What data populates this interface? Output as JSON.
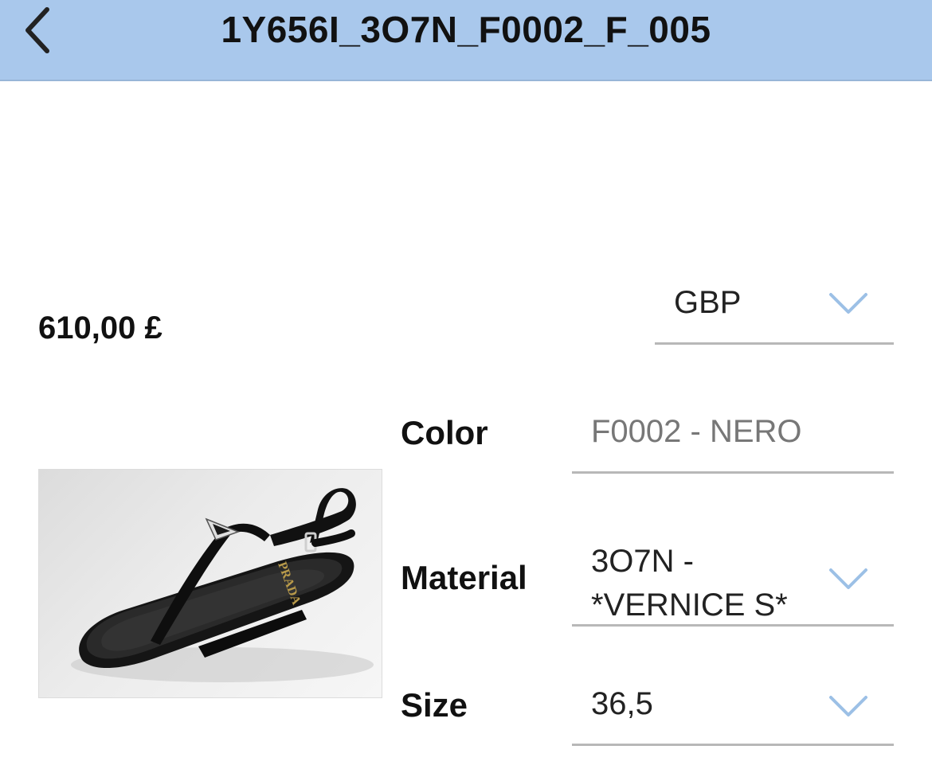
{
  "header": {
    "title": "1Y656I_3O7N_F0002_F_005",
    "back_icon": "chevron-left-icon"
  },
  "product": {
    "price": "610,00 £",
    "currency": {
      "selected": "GBP",
      "icon": "chevron-down-icon"
    },
    "image": {
      "alt": "PRADA",
      "logo_text": "PRADA"
    },
    "attributes": {
      "color": {
        "label": "Color",
        "value": "F0002 - NERO"
      },
      "material": {
        "label": "Material",
        "value_line1": "3O7N -",
        "value_line2": "*VERNICE S*",
        "icon": "chevron-down-icon"
      },
      "size": {
        "label": "Size",
        "value": "36,5",
        "icon": "chevron-down-icon"
      }
    }
  },
  "colors": {
    "header_bg": "#a9c8ec",
    "chevron": "#9cc0e6",
    "divider": "#b8b8b8"
  }
}
